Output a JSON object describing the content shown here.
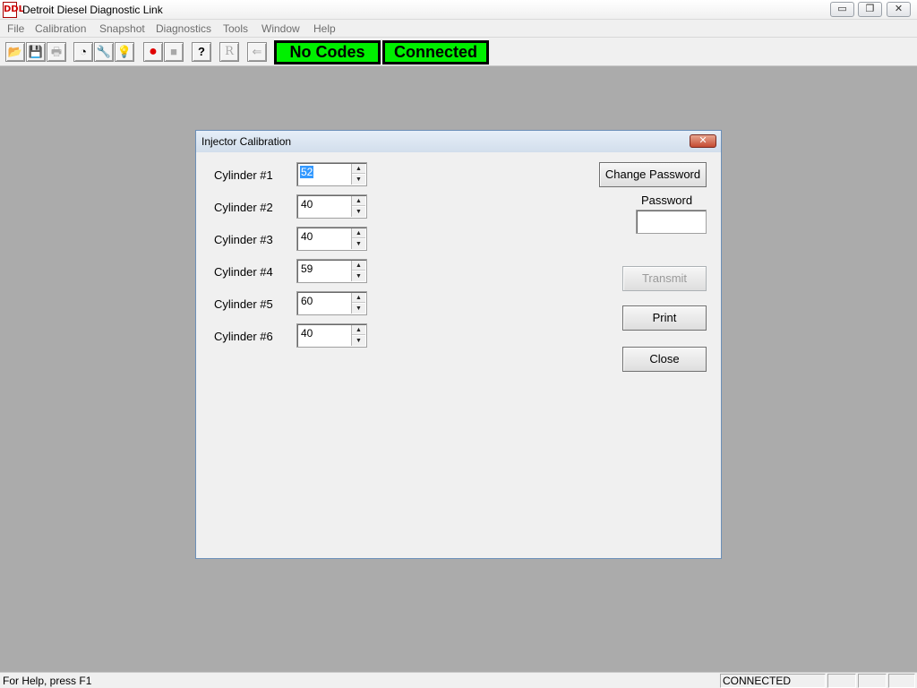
{
  "app": {
    "title": "Detroit Diesel Diagnostic Link",
    "icon_text": "DDL",
    "icon": "ddl-app-icon"
  },
  "window_controls": {
    "minimize": "▭",
    "restore": "❐",
    "close": "✕"
  },
  "menu": [
    "File",
    "Calibration",
    "Snapshot",
    "Diagnostics",
    "Tools",
    "Window",
    "Help"
  ],
  "toolbar": {
    "buttons": [
      {
        "icon": "open-folder-icon",
        "glyph": "📂"
      },
      {
        "icon": "save-icon",
        "glyph": "💾"
      },
      {
        "icon": "print-icon",
        "glyph": "🖶"
      },
      {
        "icon": "gauge-icon",
        "glyph": "◔"
      },
      {
        "icon": "wrench-icon",
        "glyph": "🔧"
      },
      {
        "icon": "lightbulb-icon",
        "glyph": "💡"
      },
      {
        "icon": "record-icon",
        "glyph": "●"
      },
      {
        "icon": "stop-icon",
        "glyph": "■"
      },
      {
        "icon": "help-icon",
        "glyph": "?"
      },
      {
        "icon": "reset-icon",
        "glyph": "R"
      },
      {
        "icon": "exit-icon",
        "glyph": "⇐"
      }
    ],
    "codes_status": "No Codes",
    "connection_status": "Connected",
    "status_color": "#00f000"
  },
  "dialog": {
    "title": "Injector Calibration",
    "close_glyph": "✕",
    "cylinders": [
      {
        "label": "Cylinder #1",
        "value": "52"
      },
      {
        "label": "Cylinder #2",
        "value": "40"
      },
      {
        "label": "Cylinder #3",
        "value": "40"
      },
      {
        "label": "Cylinder #4",
        "value": "59"
      },
      {
        "label": "Cylinder #5",
        "value": "60"
      },
      {
        "label": "Cylinder #6",
        "value": "40"
      }
    ],
    "spin_up": "▲",
    "spin_down": "▼",
    "change_password": "Change Password",
    "password_label": "Password",
    "password_value": "",
    "transmit": "Transmit",
    "print": "Print",
    "close": "Close"
  },
  "statusbar": {
    "help_text": "For Help, press F1",
    "connection": "CONNECTED"
  }
}
